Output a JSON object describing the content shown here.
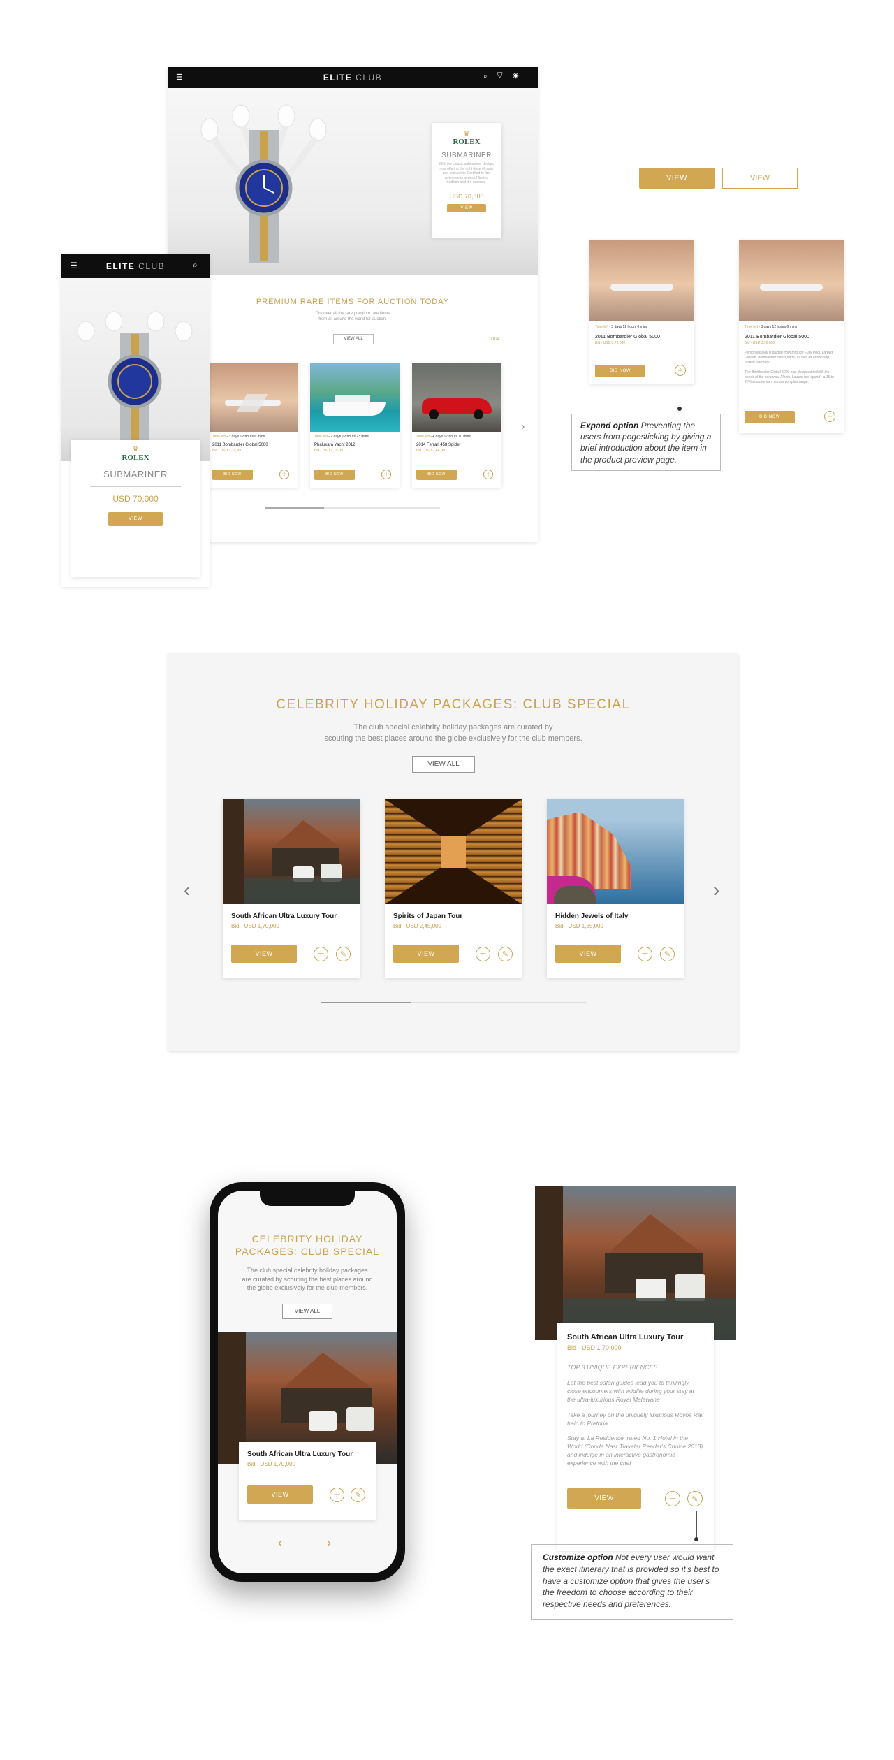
{
  "desktop": {
    "brand_bold": "ELITE",
    "brand_light": "CLUB",
    "hero_card": {
      "brand": "ROLEX",
      "model": "SUBMARINER",
      "desc": "With the classic submariner design, now offering the right dose of rarity and exclusivity. Certified to first reference in series of limited tradition and the essence.",
      "price": "USD 70,000",
      "button": "VIEW"
    },
    "section_title": "PREMIUM RARE ITEMS FOR AUCTION TODAY",
    "section_sub1": "Discover all the rare premium rare items",
    "section_sub2": "from all around the world for auction.",
    "view_all": "VIEW ALL",
    "pager": "01/04",
    "items": [
      {
        "time_label": "Time left",
        "time": " - 3 days 12 hours 6 mins",
        "name": "2011 Bombardier Global 5000",
        "bid": "Bid - USD 3,70,000",
        "button": "BID NOW",
        "plus": "+"
      },
      {
        "time_label": "Time left",
        "time": " - 2 days 12 hours 23 mins",
        "name": "Phaluxara Yacht 2012",
        "bid": "Bid - USD 2,70,000",
        "button": "BID NOW",
        "plus": "+"
      },
      {
        "time_label": "Time left",
        "time": " - 4 days 17 hours 10 mins",
        "name": "2014 Ferrari 458 Spider",
        "bid": "Bid - USD 1,44,000",
        "button": "BID NOW",
        "plus": "+"
      }
    ]
  },
  "mobile_top": {
    "brand_bold": "ELITE",
    "brand_light": "CLUB",
    "brand": "ROLEX",
    "model": "SUBMARINER",
    "price": "USD 70,000",
    "button": "VIEW"
  },
  "buttons_demo": {
    "filled": "VIEW",
    "outline": "VIEW"
  },
  "expand_cards": [
    {
      "time_label": "Time left",
      "time": " - 3 days 12 hours 6 mins",
      "name": "2011 Bombardier Global 5000",
      "bid": "Bid - USD 3,70,000",
      "button": "BID NOW",
      "icon": "+"
    },
    {
      "time_label": "Time left",
      "time": " - 3 days 12 hours 6 mins",
      "name": "2011 Bombardier Global 5000",
      "bid": "Bid - USD 3,70,000",
      "desc1": "Personal travel is guided from through Fully Pool, Larged Gerium, Bombardier rarest parts, as well as enhancing fastest warranty.",
      "desc2": "The Bombardier Global 5000 was designed to fulfill the needs of the corporate Fleets. Lowest fuel spend - a 15 to 20% improvement across complex range.",
      "button": "BID NOW",
      "icon": "−"
    }
  ],
  "expand_note": {
    "title": "Expand option",
    "text": "Preventing the users from pogosticking by giving a brief introduction about the item in the product preview page."
  },
  "holiday": {
    "title": "CELEBRITY HOLIDAY PACKAGES: CLUB SPECIAL",
    "sub1": "The club special celebrity holiday packages are curated by",
    "sub2": "scouting the best places around the globe exclusively for the club members.",
    "view_all": "VIEW ALL",
    "packages": [
      {
        "name": "South African Ultra Luxury Tour",
        "bid": "Bid - USD 1,70,000",
        "button": "VIEW"
      },
      {
        "name": "Spirits of Japan Tour",
        "bid": "Bid - USD 2,45,000",
        "button": "VIEW"
      },
      {
        "name": "Hidden Jewels of Italy",
        "bid": "Bid - USD 1,65,000",
        "button": "VIEW"
      }
    ]
  },
  "phone": {
    "title1": "CELEBRITY HOLIDAY",
    "title2": "PACKAGES: CLUB SPECIAL",
    "sub1": "The club special celebrity holiday packages",
    "sub2": "are curated by scouting the best places around",
    "sub3": "the globe exclusively for the club members.",
    "view_all": "VIEW ALL",
    "card": {
      "name": "South African Ultra Luxury Tour",
      "bid": "Bid - USD 1,70,000",
      "button": "VIEW"
    }
  },
  "custom_card": {
    "name": "South African Ultra Luxury Tour",
    "bid": "Bid - USD 1,70,000",
    "heading": "TOP 3 UNIQUE EXPERIENCES",
    "p1": "Let the best safari guides lead you to thrillingly close encounters with wildlife during your stay at the ultra-luxurious Royal Malewane",
    "p2": "Take a journey on the uniquely luxurious Rovos Rail train to Pretoria",
    "p3": "Stay at La Residence, rated No. 1 Hotel in the World (Conde Nast Traveler Reader's Choice 2013) and indulge in an interactive gastronomic experience with the chef",
    "button": "VIEW"
  },
  "custom_note": {
    "title": "Customize option",
    "text": "Not every user would want the exact itinerary that is provided so it's best to have a customize option that gives the user's the freedom to choose according to their respective needs and preferences."
  },
  "colors": {
    "gold": "#d1a753",
    "dark": "#0e0e0e",
    "panel": "#f5f5f5"
  }
}
